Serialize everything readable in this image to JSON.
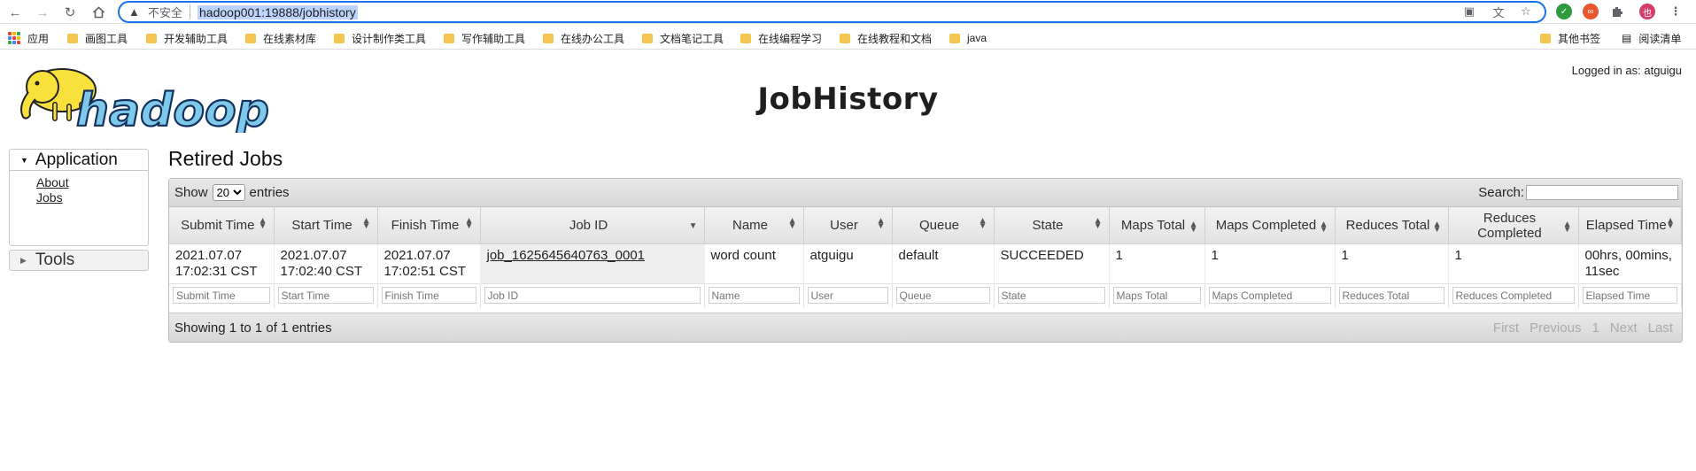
{
  "browser": {
    "security_label": "不安全",
    "url": "hadoop001:19888/jobhistory",
    "profile_initial": "也"
  },
  "bookmarks": {
    "apps_label": "应用",
    "folders": [
      "画图工具",
      "开发辅助工具",
      "在线素材库",
      "设计制作类工具",
      "写作辅助工具",
      "在线办公工具",
      "文档笔记工具",
      "在线编程学习",
      "在线教程和文档",
      "java"
    ],
    "other": "其他书签",
    "reading_list": "阅读清单"
  },
  "header": {
    "title": "JobHistory",
    "logged_in": "Logged in as: atguigu"
  },
  "sidebar": {
    "application": "Application",
    "about": "About",
    "jobs": "Jobs",
    "tools": "Tools"
  },
  "table": {
    "section_title": "Retired Jobs",
    "show_label": "Show",
    "entries_value": "20",
    "entries_label": "entries",
    "search_label": "Search:",
    "columns": [
      "Submit Time",
      "Start Time",
      "Finish Time",
      "Job ID",
      "Name",
      "User",
      "Queue",
      "State",
      "Maps Total",
      "Maps Completed",
      "Reduces Total",
      "Reduces Completed",
      "Elapsed Time"
    ],
    "rows": [
      {
        "submit_time": "2021.07.07 17:02:31 CST",
        "start_time": "2021.07.07 17:02:40 CST",
        "finish_time": "2021.07.07 17:02:51 CST",
        "job_id": "job_1625645640763_0001",
        "name": "word count",
        "user": "atguigu",
        "queue": "default",
        "state": "SUCCEEDED",
        "maps_total": "1",
        "maps_completed": "1",
        "reduces_total": "1",
        "reduces_completed": "1",
        "elapsed_time": "00hrs, 00mins, 11sec"
      }
    ],
    "footer": "Showing 1 to 1 of 1 entries",
    "pager": {
      "first": "First",
      "previous": "Previous",
      "page": "1",
      "next": "Next",
      "last": "Last"
    }
  }
}
